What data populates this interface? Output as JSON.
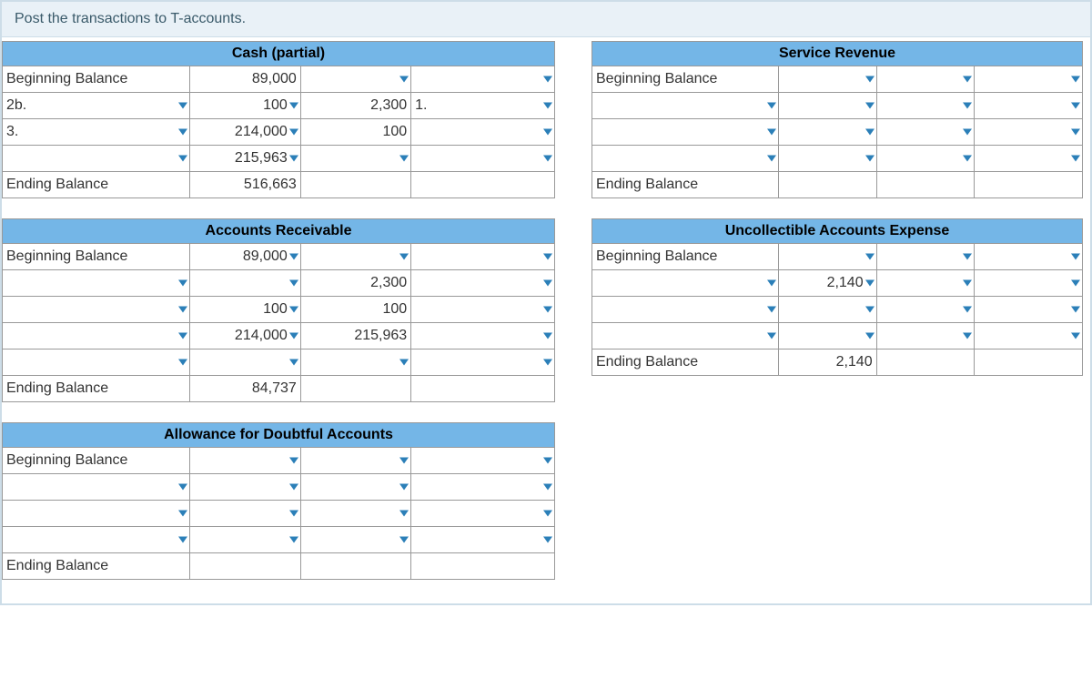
{
  "instruction": "Post the transactions to T-accounts.",
  "labels": {
    "begin": "Beginning Balance",
    "end": "Ending Balance"
  },
  "accounts": {
    "cash": {
      "title": "Cash (partial)",
      "rows": [
        {
          "l_lbl": "Beginning Balance",
          "l_amt": "89,000",
          "r_amt": "",
          "r_lbl": ""
        },
        {
          "l_lbl": "2b.",
          "l_amt": "100",
          "r_amt": "2,300",
          "r_lbl": "1."
        },
        {
          "l_lbl": "3.",
          "l_amt": "214,000",
          "r_amt": "100",
          "r_lbl": ""
        },
        {
          "l_lbl": "",
          "l_amt": "215,963",
          "r_amt": "",
          "r_lbl": ""
        }
      ],
      "end": {
        "l_lbl": "Ending Balance",
        "l_amt": "516,663",
        "r_amt": "",
        "r_lbl": ""
      }
    },
    "ar": {
      "title": "Accounts Receivable",
      "rows": [
        {
          "l_lbl": "Beginning Balance",
          "l_amt": "89,000",
          "r_amt": "",
          "r_lbl": ""
        },
        {
          "l_lbl": "",
          "l_amt": "",
          "r_amt": "2,300",
          "r_lbl": ""
        },
        {
          "l_lbl": "",
          "l_amt": "100",
          "r_amt": "100",
          "r_lbl": ""
        },
        {
          "l_lbl": "",
          "l_amt": "214,000",
          "r_amt": "215,963",
          "r_lbl": ""
        },
        {
          "l_lbl": "",
          "l_amt": "",
          "r_amt": "",
          "r_lbl": ""
        }
      ],
      "end": {
        "l_lbl": "Ending Balance",
        "l_amt": "84,737",
        "r_amt": "",
        "r_lbl": ""
      }
    },
    "ada": {
      "title": "Allowance for Doubtful Accounts",
      "rows": [
        {
          "l_lbl": "Beginning Balance",
          "l_amt": "",
          "r_amt": "",
          "r_lbl": ""
        },
        {
          "l_lbl": "",
          "l_amt": "",
          "r_amt": "",
          "r_lbl": ""
        },
        {
          "l_lbl": "",
          "l_amt": "",
          "r_amt": "",
          "r_lbl": ""
        },
        {
          "l_lbl": "",
          "l_amt": "",
          "r_amt": "",
          "r_lbl": ""
        }
      ],
      "end": {
        "l_lbl": "Ending Balance",
        "l_amt": "",
        "r_amt": "",
        "r_lbl": ""
      }
    },
    "svc": {
      "title": "Service Revenue",
      "rows": [
        {
          "l_lbl": "Beginning Balance",
          "l_amt": "",
          "r_amt": "",
          "r_lbl": ""
        },
        {
          "l_lbl": "",
          "l_amt": "",
          "r_amt": "",
          "r_lbl": ""
        },
        {
          "l_lbl": "",
          "l_amt": "",
          "r_amt": "",
          "r_lbl": ""
        },
        {
          "l_lbl": "",
          "l_amt": "",
          "r_amt": "",
          "r_lbl": ""
        }
      ],
      "end": {
        "l_lbl": "Ending Balance",
        "l_amt": "",
        "r_amt": "",
        "r_lbl": ""
      }
    },
    "uae": {
      "title": "Uncollectible Accounts Expense",
      "rows": [
        {
          "l_lbl": "Beginning Balance",
          "l_amt": "",
          "r_amt": "",
          "r_lbl": ""
        },
        {
          "l_lbl": "",
          "l_amt": "2,140",
          "r_amt": "",
          "r_lbl": ""
        },
        {
          "l_lbl": "",
          "l_amt": "",
          "r_amt": "",
          "r_lbl": ""
        },
        {
          "l_lbl": "",
          "l_amt": "",
          "r_amt": "",
          "r_lbl": ""
        }
      ],
      "end": {
        "l_lbl": "Ending Balance",
        "l_amt": "2,140",
        "r_amt": "",
        "r_lbl": ""
      }
    }
  }
}
